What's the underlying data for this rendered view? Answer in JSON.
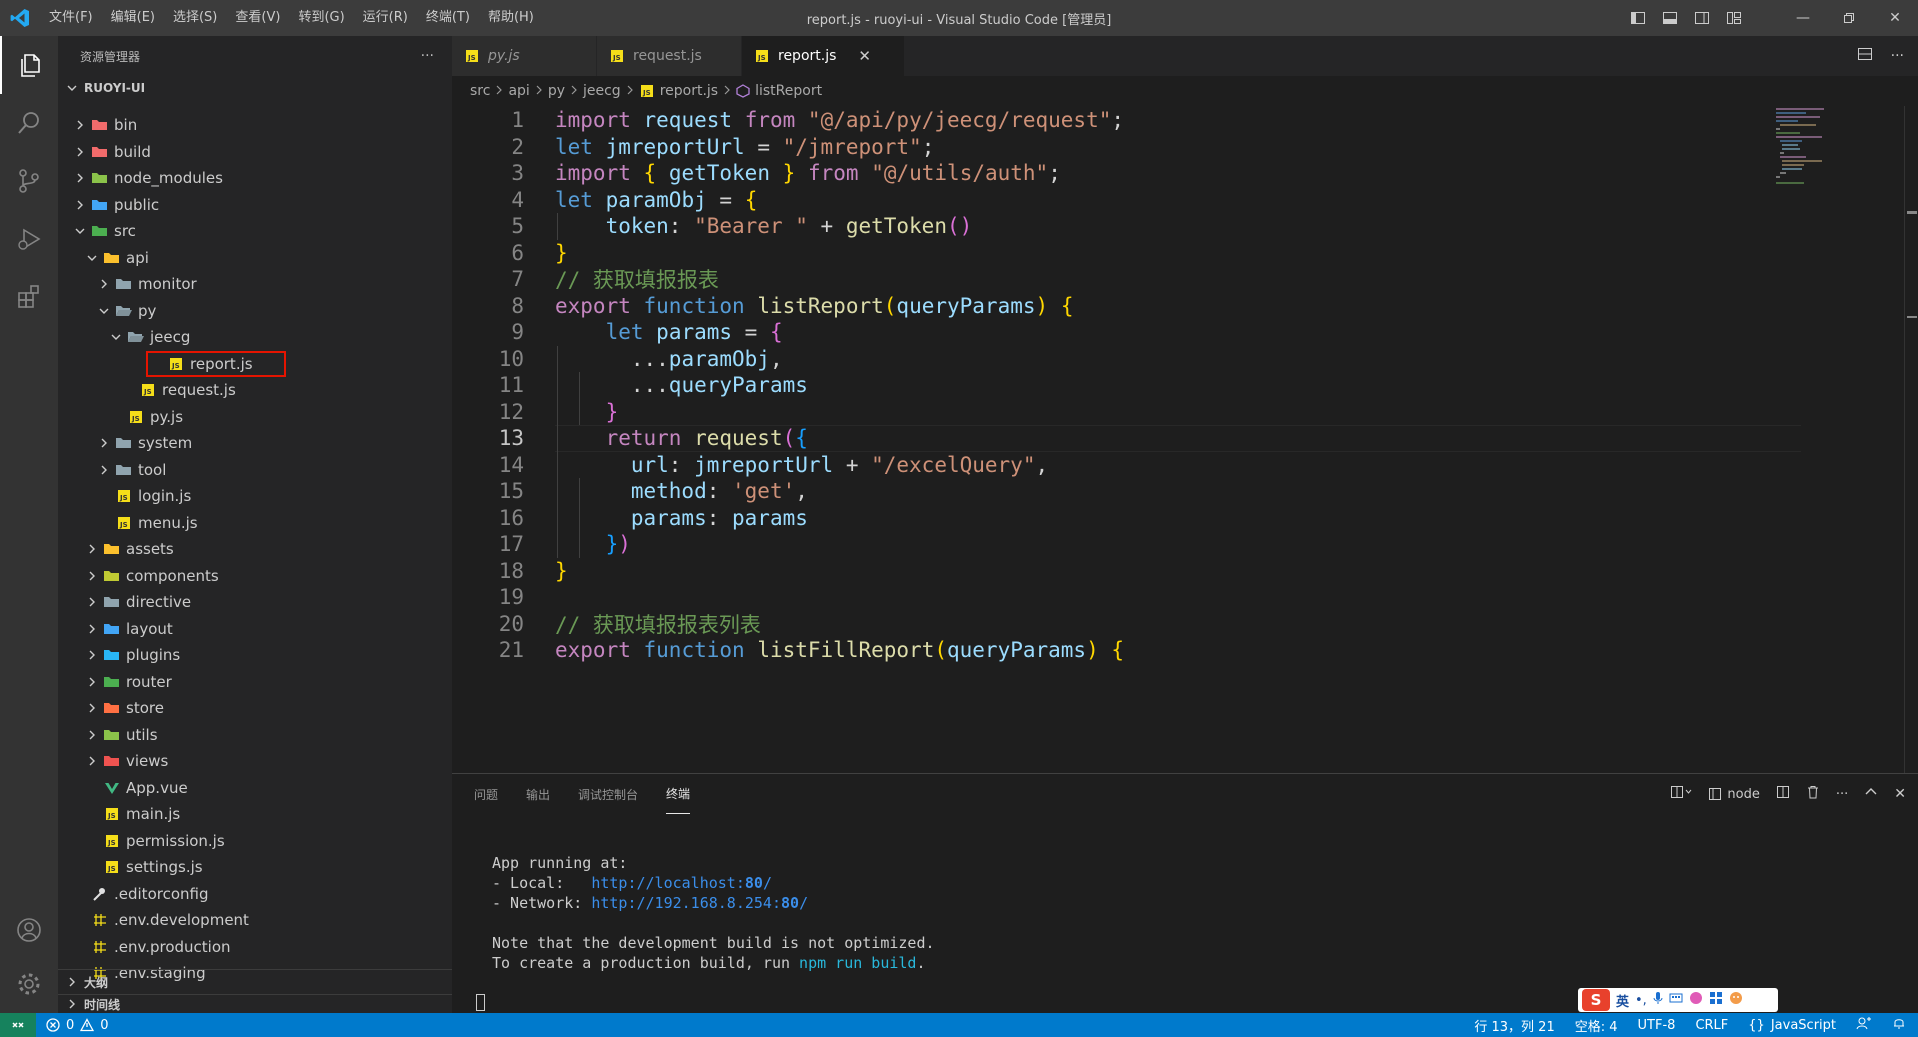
{
  "window": {
    "title": "report.js - ruoyi-ui - Visual Studio Code [管理员]",
    "menu": [
      "文件(F)",
      "编辑(E)",
      "选择(S)",
      "查看(V)",
      "转到(G)",
      "运行(R)",
      "终端(T)",
      "帮助(H)"
    ]
  },
  "sidebar": {
    "title": "资源管理器",
    "more": "···",
    "root": "RUOYI-UI",
    "tree": [
      {
        "label": "bin",
        "indent": 0,
        "chev": "right",
        "icon": "folder-bin-icon",
        "color": "#f26b6b"
      },
      {
        "label": "build",
        "indent": 0,
        "chev": "right",
        "icon": "folder-build-icon",
        "color": "#f26b6b"
      },
      {
        "label": "node_modules",
        "indent": 0,
        "chev": "right",
        "icon": "folder-node-icon",
        "color": "#8bc34a"
      },
      {
        "label": "public",
        "indent": 0,
        "chev": "right",
        "icon": "folder-public-icon",
        "color": "#42a5f5"
      },
      {
        "label": "src",
        "indent": 0,
        "chev": "down",
        "icon": "folder-src-icon",
        "color": "#4caf50"
      },
      {
        "label": "api",
        "indent": 1,
        "chev": "down",
        "icon": "folder-api-icon",
        "color": "#fbc02d"
      },
      {
        "label": "monitor",
        "indent": 2,
        "chev": "right",
        "icon": "folder-icon",
        "color": "#90a4ae"
      },
      {
        "label": "py",
        "indent": 2,
        "chev": "down",
        "icon": "folder-open-icon",
        "color": "#90a4ae"
      },
      {
        "label": "jeecg",
        "indent": 3,
        "chev": "down",
        "icon": "folder-open-icon",
        "color": "#90a4ae"
      },
      {
        "label": "report.js",
        "indent": 4,
        "chev": "none",
        "icon": "js-file-icon",
        "color": "#f5de19",
        "selected": true
      },
      {
        "label": "request.js",
        "indent": 4,
        "chev": "none",
        "icon": "js-file-icon",
        "color": "#f5de19"
      },
      {
        "label": "py.js",
        "indent": 3,
        "chev": "none",
        "icon": "js-file-icon",
        "color": "#f5de19"
      },
      {
        "label": "system",
        "indent": 2,
        "chev": "right",
        "icon": "folder-icon",
        "color": "#90a4ae"
      },
      {
        "label": "tool",
        "indent": 2,
        "chev": "right",
        "icon": "folder-icon",
        "color": "#90a4ae"
      },
      {
        "label": "login.js",
        "indent": 2,
        "chev": "none",
        "icon": "js-file-icon",
        "color": "#f5de19"
      },
      {
        "label": "menu.js",
        "indent": 2,
        "chev": "none",
        "icon": "js-file-icon",
        "color": "#f5de19"
      },
      {
        "label": "assets",
        "indent": 1,
        "chev": "right",
        "icon": "folder-assets-icon",
        "color": "#fbc02d"
      },
      {
        "label": "components",
        "indent": 1,
        "chev": "right",
        "icon": "folder-components-icon",
        "color": "#c0ca33"
      },
      {
        "label": "directive",
        "indent": 1,
        "chev": "right",
        "icon": "folder-icon",
        "color": "#90a4ae"
      },
      {
        "label": "layout",
        "indent": 1,
        "chev": "right",
        "icon": "folder-layout-icon",
        "color": "#42a5f5"
      },
      {
        "label": "plugins",
        "indent": 1,
        "chev": "right",
        "icon": "folder-plugins-icon",
        "color": "#29b6f6"
      },
      {
        "label": "router",
        "indent": 1,
        "chev": "right",
        "icon": "folder-router-icon",
        "color": "#4caf50"
      },
      {
        "label": "store",
        "indent": 1,
        "chev": "right",
        "icon": "folder-store-icon",
        "color": "#ff7043"
      },
      {
        "label": "utils",
        "indent": 1,
        "chev": "right",
        "icon": "folder-utils-icon",
        "color": "#8bc34a"
      },
      {
        "label": "views",
        "indent": 1,
        "chev": "right",
        "icon": "folder-views-icon",
        "color": "#ef5350"
      },
      {
        "label": "App.vue",
        "indent": 1,
        "chev": "none",
        "icon": "vue-file-icon",
        "color": "#41b883"
      },
      {
        "label": "main.js",
        "indent": 1,
        "chev": "none",
        "icon": "js-file-icon",
        "color": "#f5de19"
      },
      {
        "label": "permission.js",
        "indent": 1,
        "chev": "none",
        "icon": "js-file-icon",
        "color": "#f5de19"
      },
      {
        "label": "settings.js",
        "indent": 1,
        "chev": "none",
        "icon": "js-file-icon",
        "color": "#f5de19"
      },
      {
        "label": ".editorconfig",
        "indent": 0,
        "chev": "none",
        "icon": "editorconfig-icon",
        "color": "#e0e0e0"
      },
      {
        "label": ".env.development",
        "indent": 0,
        "chev": "none",
        "icon": "env-file-icon",
        "color": "#f5de19"
      },
      {
        "label": ".env.production",
        "indent": 0,
        "chev": "none",
        "icon": "env-file-icon",
        "color": "#f5de19"
      },
      {
        "label": ".env.staging",
        "indent": 0,
        "chev": "none",
        "icon": "env-file-icon",
        "color": "#f5de19"
      }
    ],
    "outline": "大纲",
    "timeline": "时间线"
  },
  "tabs": [
    {
      "label": "py.js",
      "active": false,
      "italic": true
    },
    {
      "label": "request.js",
      "active": false,
      "italic": false
    },
    {
      "label": "report.js",
      "active": true,
      "italic": false
    }
  ],
  "tab_close": "✕",
  "breadcrumbs": [
    "src",
    "api",
    "py",
    "jeecg",
    "report.js",
    "listReport"
  ],
  "editor": {
    "current_line": 13,
    "lines": [
      {
        "n": 1,
        "tokens": [
          [
            "k",
            "import"
          ],
          [
            "p",
            " "
          ],
          [
            "v",
            "request"
          ],
          [
            "p",
            " "
          ],
          [
            "k",
            "from"
          ],
          [
            "p",
            " "
          ],
          [
            "s",
            "\"@/api/py/jeecg/request\""
          ],
          [
            "p",
            ";"
          ]
        ]
      },
      {
        "n": 2,
        "tokens": [
          [
            "b",
            "let"
          ],
          [
            "p",
            " "
          ],
          [
            "v",
            "jmreportUrl"
          ],
          [
            "p",
            " = "
          ],
          [
            "s",
            "\"/jmreport\""
          ],
          [
            "p",
            ";"
          ]
        ]
      },
      {
        "n": 3,
        "tokens": [
          [
            "k",
            "import"
          ],
          [
            "p",
            " "
          ],
          [
            "y",
            "{"
          ],
          [
            "p",
            " "
          ],
          [
            "v",
            "getToken"
          ],
          [
            "p",
            " "
          ],
          [
            "y",
            "}"
          ],
          [
            "p",
            " "
          ],
          [
            "k",
            "from"
          ],
          [
            "p",
            " "
          ],
          [
            "s",
            "\"@/utils/auth\""
          ],
          [
            "p",
            ";"
          ]
        ]
      },
      {
        "n": 4,
        "tokens": [
          [
            "b",
            "let"
          ],
          [
            "p",
            " "
          ],
          [
            "v",
            "paramObj"
          ],
          [
            "p",
            " = "
          ],
          [
            "y",
            "{"
          ]
        ]
      },
      {
        "n": 5,
        "tokens": [
          [
            "p",
            "    "
          ],
          [
            "v",
            "token"
          ],
          [
            "p",
            ": "
          ],
          [
            "s",
            "\"Bearer \""
          ],
          [
            "p",
            " + "
          ],
          [
            "f",
            "getToken"
          ],
          [
            "m",
            "()"
          ]
        ]
      },
      {
        "n": 6,
        "tokens": [
          [
            "y",
            "}"
          ]
        ]
      },
      {
        "n": 7,
        "tokens": [
          [
            "c",
            "// 获取填报报表"
          ]
        ]
      },
      {
        "n": 8,
        "tokens": [
          [
            "k",
            "export"
          ],
          [
            "p",
            " "
          ],
          [
            "b",
            "function"
          ],
          [
            "p",
            " "
          ],
          [
            "f",
            "listReport"
          ],
          [
            "y",
            "("
          ],
          [
            "v",
            "queryParams"
          ],
          [
            "y",
            ")"
          ],
          [
            "p",
            " "
          ],
          [
            "y",
            "{"
          ]
        ]
      },
      {
        "n": 9,
        "tokens": [
          [
            "p",
            "    "
          ],
          [
            "b",
            "let"
          ],
          [
            "p",
            " "
          ],
          [
            "v",
            "params"
          ],
          [
            "p",
            " = "
          ],
          [
            "m",
            "{"
          ]
        ]
      },
      {
        "n": 10,
        "tokens": [
          [
            "p",
            "      ..."
          ],
          [
            "v",
            "paramObj"
          ],
          [
            "p",
            ","
          ]
        ]
      },
      {
        "n": 11,
        "tokens": [
          [
            "p",
            "      ..."
          ],
          [
            "v",
            "queryParams"
          ]
        ]
      },
      {
        "n": 12,
        "tokens": [
          [
            "p",
            "    "
          ],
          [
            "m",
            "}"
          ]
        ]
      },
      {
        "n": 13,
        "tokens": [
          [
            "p",
            "    "
          ],
          [
            "k",
            "return"
          ],
          [
            "p",
            " "
          ],
          [
            "f",
            "request"
          ],
          [
            "m",
            "("
          ],
          [
            "bl",
            "{"
          ]
        ]
      },
      {
        "n": 14,
        "tokens": [
          [
            "p",
            "      "
          ],
          [
            "v",
            "url"
          ],
          [
            "p",
            ": "
          ],
          [
            "v",
            "jmreportUrl"
          ],
          [
            "p",
            " + "
          ],
          [
            "s",
            "\"/excelQuery\""
          ],
          [
            "p",
            ","
          ]
        ]
      },
      {
        "n": 15,
        "tokens": [
          [
            "p",
            "      "
          ],
          [
            "v",
            "method"
          ],
          [
            "p",
            ": "
          ],
          [
            "s",
            "'get'"
          ],
          [
            "p",
            ","
          ]
        ]
      },
      {
        "n": 16,
        "tokens": [
          [
            "p",
            "      "
          ],
          [
            "v",
            "params"
          ],
          [
            "p",
            ": "
          ],
          [
            "v",
            "params"
          ]
        ]
      },
      {
        "n": 17,
        "tokens": [
          [
            "p",
            "    "
          ],
          [
            "bl",
            "}"
          ],
          [
            "m",
            ")"
          ]
        ]
      },
      {
        "n": 18,
        "tokens": [
          [
            "y",
            "}"
          ]
        ]
      },
      {
        "n": 19,
        "tokens": []
      },
      {
        "n": 20,
        "tokens": [
          [
            "c",
            "// 获取填报报表列表"
          ]
        ]
      },
      {
        "n": 21,
        "tokens": [
          [
            "k",
            "export"
          ],
          [
            "p",
            " "
          ],
          [
            "b",
            "function"
          ],
          [
            "p",
            " "
          ],
          [
            "f",
            "listFillReport"
          ],
          [
            "y",
            "("
          ],
          [
            "v",
            "queryParams"
          ],
          [
            "y",
            ")"
          ],
          [
            "p",
            " "
          ],
          [
            "y",
            "{"
          ]
        ]
      }
    ]
  },
  "panel": {
    "tabs": [
      "问题",
      "输出",
      "调试控制台",
      "终端"
    ],
    "active_tab": "终端",
    "terminal_name": "node",
    "terminal": {
      "running": "App running at:",
      "local_label": "- Local:   ",
      "local_url_a": "http://localhost:",
      "local_url_port": "80",
      "local_url_b": "/",
      "network_label": "- Network: ",
      "network_url_a": "http://192.168.8.254:",
      "network_url_port": "80",
      "network_url_b": "/",
      "note": "Note that the development build is not optimized.",
      "build_a": "To create a production build, run ",
      "build_cmd": "npm run build",
      "build_b": "."
    }
  },
  "ime": {
    "logo": "S",
    "lang": "英"
  },
  "statusbar": {
    "errors": "0",
    "warnings": "0",
    "position": "行 13，列 21",
    "spaces": "空格: 4",
    "encoding": "UTF-8",
    "eol": "CRLF",
    "language_brace": "{}",
    "language": "JavaScript"
  },
  "colors": {
    "statusbar": "#007acc",
    "remote": "#16825d",
    "selection_outline": "#e51400"
  }
}
